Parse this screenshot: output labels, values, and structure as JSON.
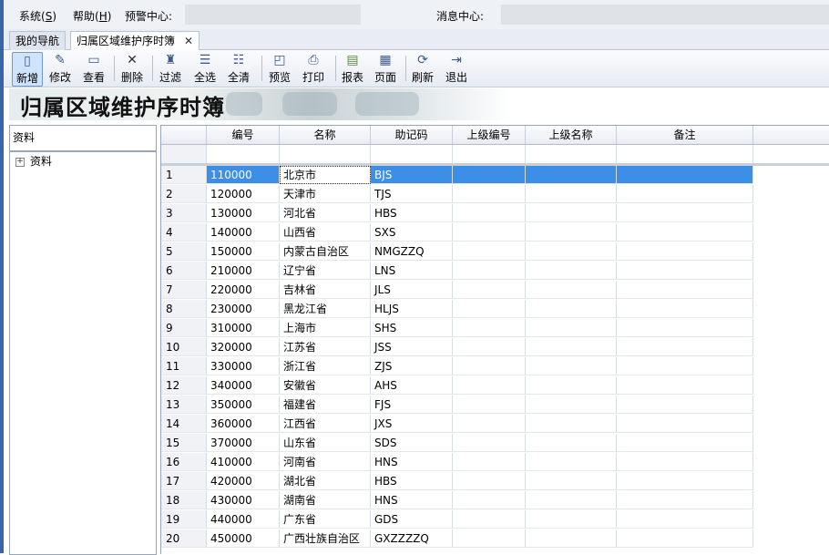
{
  "menu": {
    "system_prefix": "系统(",
    "system_key": "S",
    "system_suffix": ")",
    "help_prefix": "帮助(",
    "help_key": "H",
    "help_suffix": ")",
    "warning_label": "预警中心:",
    "message_label": "消息中心:"
  },
  "tabs": [
    {
      "label": "我的导航"
    },
    {
      "label": "归属区域维护序时簿",
      "close": "✕"
    }
  ],
  "toolbar": {
    "buttons": [
      {
        "label": "新增",
        "icon": "new-doc-icon"
      },
      {
        "label": "修改",
        "icon": "edit-icon"
      },
      {
        "label": "查看",
        "icon": "view-icon"
      },
      {
        "label": "删除",
        "icon": "delete-icon"
      },
      {
        "label": "过滤",
        "icon": "filter-icon"
      },
      {
        "label": "全选",
        "icon": "select-all-icon"
      },
      {
        "label": "全清",
        "icon": "clear-all-icon"
      },
      {
        "label": "预览",
        "icon": "preview-icon"
      },
      {
        "label": "打印",
        "icon": "print-icon"
      },
      {
        "label": "报表",
        "icon": "report-icon"
      },
      {
        "label": "页面",
        "icon": "page-icon"
      },
      {
        "label": "刷新",
        "icon": "refresh-icon"
      },
      {
        "label": "退出",
        "icon": "exit-icon"
      }
    ]
  },
  "banner": {
    "title": "归属区域维护序时簿"
  },
  "left_panel": {
    "header": "资料",
    "tree_root": "资料",
    "expander": "+"
  },
  "grid": {
    "columns": [
      "编号",
      "名称",
      "助记码",
      "上级编号",
      "上级名称",
      "备注"
    ],
    "rows": [
      {
        "n": "1",
        "code": "110000",
        "name": "北京市",
        "mnemonic": "BJS"
      },
      {
        "n": "2",
        "code": "120000",
        "name": "天津市",
        "mnemonic": "TJS"
      },
      {
        "n": "3",
        "code": "130000",
        "name": "河北省",
        "mnemonic": "HBS"
      },
      {
        "n": "4",
        "code": "140000",
        "name": "山西省",
        "mnemonic": "SXS"
      },
      {
        "n": "5",
        "code": "150000",
        "name": "内蒙古自治区",
        "mnemonic": "NMGZZQ"
      },
      {
        "n": "6",
        "code": "210000",
        "name": "辽宁省",
        "mnemonic": "LNS"
      },
      {
        "n": "7",
        "code": "220000",
        "name": "吉林省",
        "mnemonic": "JLS"
      },
      {
        "n": "8",
        "code": "230000",
        "name": "黑龙江省",
        "mnemonic": "HLJS"
      },
      {
        "n": "9",
        "code": "310000",
        "name": "上海市",
        "mnemonic": "SHS"
      },
      {
        "n": "10",
        "code": "320000",
        "name": "江苏省",
        "mnemonic": "JSS"
      },
      {
        "n": "11",
        "code": "330000",
        "name": "浙江省",
        "mnemonic": "ZJS"
      },
      {
        "n": "12",
        "code": "340000",
        "name": "安徽省",
        "mnemonic": "AHS"
      },
      {
        "n": "13",
        "code": "350000",
        "name": "福建省",
        "mnemonic": "FJS"
      },
      {
        "n": "14",
        "code": "360000",
        "name": "江西省",
        "mnemonic": "JXS"
      },
      {
        "n": "15",
        "code": "370000",
        "name": "山东省",
        "mnemonic": "SDS"
      },
      {
        "n": "16",
        "code": "410000",
        "name": "河南省",
        "mnemonic": "HNS"
      },
      {
        "n": "17",
        "code": "420000",
        "name": "湖北省",
        "mnemonic": "HBS"
      },
      {
        "n": "18",
        "code": "430000",
        "name": "湖南省",
        "mnemonic": "HNS"
      },
      {
        "n": "19",
        "code": "440000",
        "name": "广东省",
        "mnemonic": "GDS"
      },
      {
        "n": "20",
        "code": "450000",
        "name": "广西壮族自治区",
        "mnemonic": "GXZZZZQ"
      }
    ]
  },
  "colors": {
    "selection": "#3d8ee6",
    "accent": "#3a64a8"
  }
}
